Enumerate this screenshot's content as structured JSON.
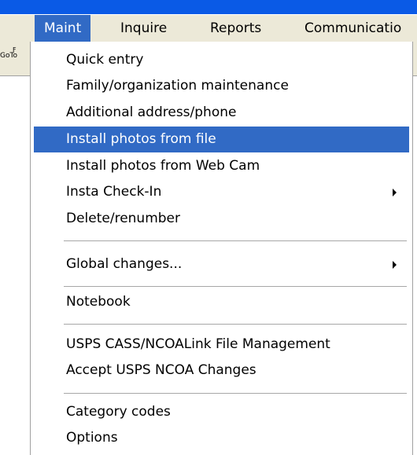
{
  "menubar": {
    "items": [
      {
        "label": "Maint"
      },
      {
        "label": "Inquire"
      },
      {
        "label": "Reports"
      },
      {
        "label": "Communicatio"
      }
    ]
  },
  "toolbar": {
    "goto_label": "GoTo",
    "goto_superscript": "F"
  },
  "maint_menu": {
    "items": [
      {
        "label": "Quick entry"
      },
      {
        "label": "Family/organization maintenance"
      },
      {
        "label": "Additional address/phone"
      },
      {
        "label": "Install photos from file"
      },
      {
        "label": "Install photos from Web Cam"
      },
      {
        "label": "Insta Check-In"
      },
      {
        "label": "Delete/renumber"
      },
      {
        "label": "Global changes..."
      },
      {
        "label": "Notebook"
      },
      {
        "label": "USPS CASS/NCOALink File Management"
      },
      {
        "label": "Accept USPS NCOA Changes"
      },
      {
        "label": "Category codes"
      },
      {
        "label": "Options"
      }
    ]
  }
}
